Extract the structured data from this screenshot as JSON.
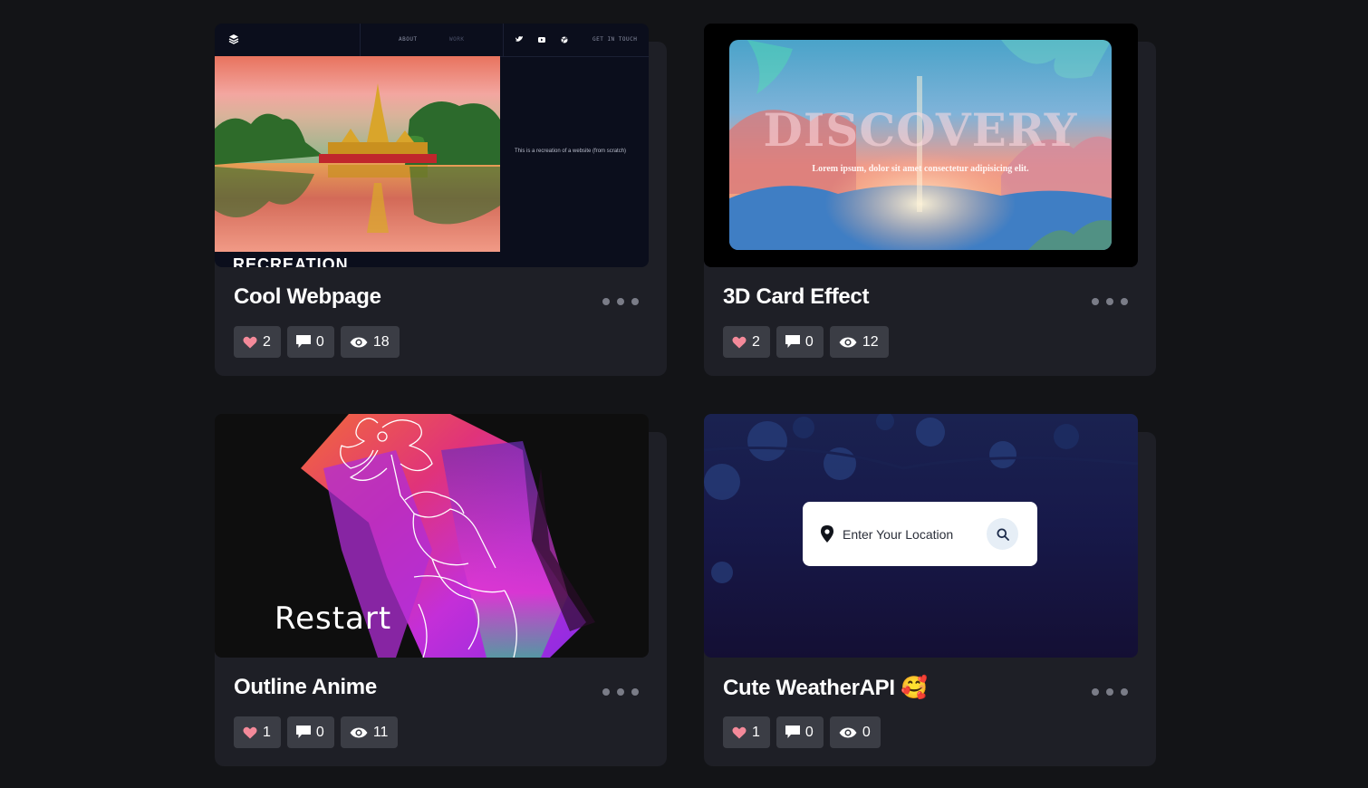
{
  "cards": [
    {
      "title": "Cool Webpage",
      "likes": "2",
      "comments": "0",
      "views": "18",
      "preview": {
        "nav_about": "ABOUT",
        "nav_work": "WORK",
        "nav_contact": "GET IN TOUCH",
        "description": "This is a recreation of a website (from scratch)",
        "heading": "RECREATION"
      }
    },
    {
      "title": "3D Card Effect",
      "likes": "2",
      "comments": "0",
      "views": "12",
      "preview": {
        "heading": "DISCOVERY",
        "subtext": "Lorem ipsum, dolor sit amet consectetur adipisicing elit."
      }
    },
    {
      "title": "Outline Anime",
      "likes": "1",
      "comments": "0",
      "views": "11",
      "preview": {
        "label": "Restart"
      }
    },
    {
      "title": "Cute WeatherAPI",
      "title_emoji": "🥰",
      "likes": "1",
      "comments": "0",
      "views": "0",
      "preview": {
        "search_placeholder": "Enter Your Location"
      }
    }
  ],
  "colors": {
    "background": "#131417",
    "card": "#1e1f26",
    "stat_button": "#3b3d45",
    "heart": "#f48a9a"
  },
  "icons": [
    "heart-icon",
    "comment-icon",
    "eye-icon",
    "more-icon",
    "location-pin-icon",
    "search-icon"
  ]
}
